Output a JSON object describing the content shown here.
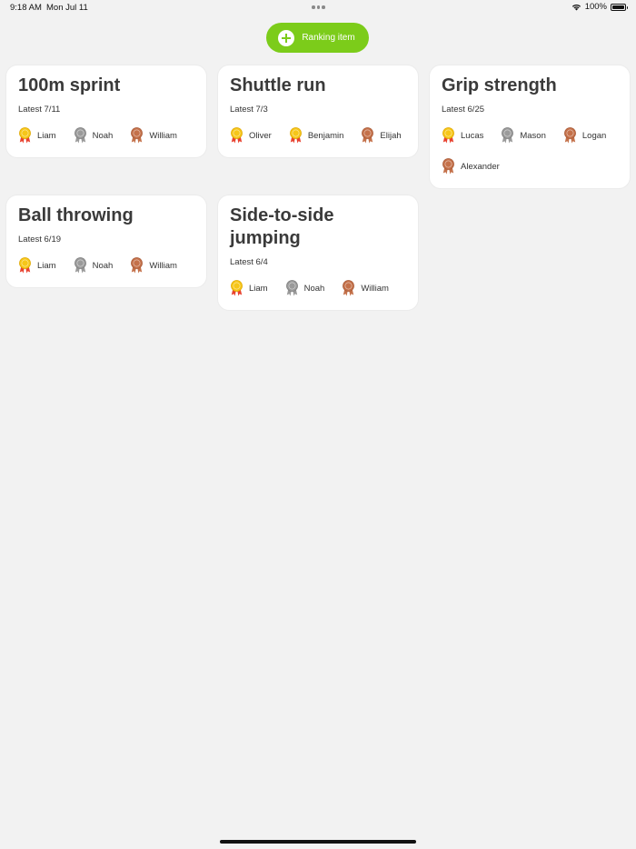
{
  "status_bar": {
    "time": "9:18 AM",
    "date": "Mon Jul 11",
    "battery": "100%",
    "battery_level": 1.0
  },
  "add_button": {
    "label": "Ranking item"
  },
  "colors": {
    "accent": "#7ccc1a",
    "gold": "#f6c619",
    "silver": "#9a9a9a",
    "bronze": "#c4714a"
  },
  "cards": [
    {
      "title": "100m sprint",
      "latest": "Latest 7/11",
      "ranks": [
        {
          "medal": "gold",
          "name": "Liam"
        },
        {
          "medal": "silver",
          "name": "Noah"
        },
        {
          "medal": "bronze",
          "name": "William"
        }
      ]
    },
    {
      "title": "Shuttle run",
      "latest": "Latest 7/3",
      "ranks": [
        {
          "medal": "gold",
          "name": "Oliver"
        },
        {
          "medal": "gold",
          "name": "Benjamin"
        },
        {
          "medal": "bronze",
          "name": "Elijah"
        }
      ]
    },
    {
      "title": "Grip strength",
      "latest": "Latest 6/25",
      "ranks": [
        {
          "medal": "gold",
          "name": "Lucas"
        },
        {
          "medal": "silver",
          "name": "Mason"
        },
        {
          "medal": "bronze",
          "name": "Logan"
        },
        {
          "medal": "bronze",
          "name": "Alexander"
        }
      ]
    },
    {
      "title": "Ball throwing",
      "latest": "Latest 6/19",
      "ranks": [
        {
          "medal": "gold",
          "name": "Liam"
        },
        {
          "medal": "silver",
          "name": "Noah"
        },
        {
          "medal": "bronze",
          "name": "William"
        }
      ]
    },
    {
      "title": "Side-to-side jumping",
      "latest": "Latest 6/4",
      "ranks": [
        {
          "medal": "gold",
          "name": "Liam"
        },
        {
          "medal": "silver",
          "name": "Noah"
        },
        {
          "medal": "bronze",
          "name": "William"
        }
      ]
    }
  ]
}
